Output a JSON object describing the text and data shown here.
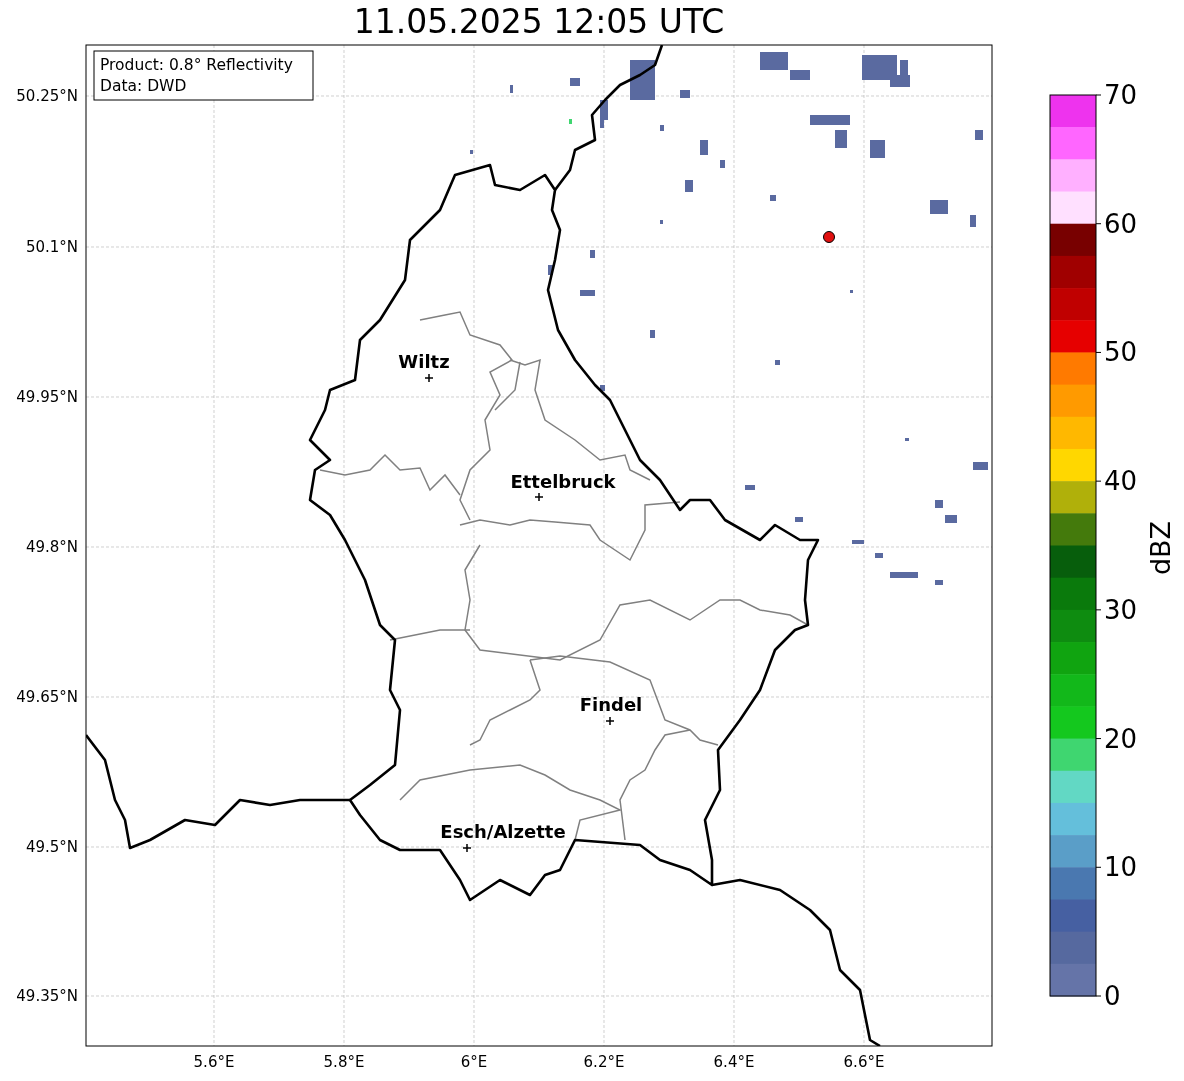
{
  "title": "11.05.2025 12:05 UTC",
  "info_box": {
    "lines": [
      "Product: 0.8° Reflectivity",
      "Data: DWD"
    ]
  },
  "map": {
    "lat_ticks": [
      "50.25°N",
      "50.1°N",
      "49.95°N",
      "49.8°N",
      "49.65°N",
      "49.5°N",
      "49.35°N"
    ],
    "lon_ticks": [
      "5.6°E",
      "5.8°E",
      "6°E",
      "6.2°E",
      "6.4°E",
      "6.6°E"
    ],
    "cities": [
      {
        "name": "Wiltz"
      },
      {
        "name": "Ettelbruck"
      },
      {
        "name": "Findel"
      },
      {
        "name": "Esch/Alzette"
      }
    ]
  },
  "colorbar": {
    "label": "dBZ",
    "ticks": [
      "70",
      "60",
      "50",
      "40",
      "30",
      "20",
      "10",
      "0"
    ],
    "bands": [
      {
        "color": "#ee33ee"
      },
      {
        "color": "#ff66ff"
      },
      {
        "color": "#ffb0ff"
      },
      {
        "color": "#ffe0ff"
      },
      {
        "color": "#780000"
      },
      {
        "color": "#a00000"
      },
      {
        "color": "#c00000"
      },
      {
        "color": "#e60000"
      },
      {
        "color": "#ff7a00"
      },
      {
        "color": "#ff9a00"
      },
      {
        "color": "#ffb800"
      },
      {
        "color": "#ffd700"
      },
      {
        "color": "#b0b00a"
      },
      {
        "color": "#447a0c"
      },
      {
        "color": "#075e0c"
      },
      {
        "color": "#0a7a0c"
      },
      {
        "color": "#0e8c10"
      },
      {
        "color": "#10a410"
      },
      {
        "color": "#12b81a"
      },
      {
        "color": "#14c81e"
      },
      {
        "color": "#3fd670"
      },
      {
        "color": "#62d8c4"
      },
      {
        "color": "#64bfdb"
      },
      {
        "color": "#5a9ec8"
      },
      {
        "color": "#4a78b0"
      },
      {
        "color": "#4660a2"
      },
      {
        "color": "#56699f"
      },
      {
        "color": "#6574a8"
      }
    ]
  }
}
